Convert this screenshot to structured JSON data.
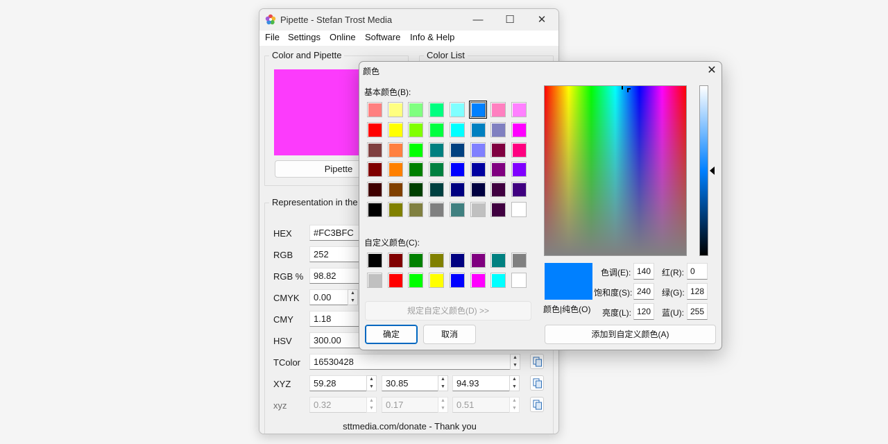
{
  "main_window": {
    "title": "Pipette - Stefan Trost Media",
    "controls": {
      "minimize": "—",
      "maximize": "☐",
      "close": "✕"
    },
    "menu": [
      "File",
      "Settings",
      "Online",
      "Software",
      "Info & Help"
    ],
    "color_group": {
      "legend": "Color and Pipette",
      "current_color": "#fc3bfc",
      "pipette_button": "Pipette"
    },
    "color_list_legend": "Color List",
    "representation": {
      "legend": "Representation in the",
      "rows": [
        {
          "label": "HEX",
          "values": [
            "#FC3BFC"
          ]
        },
        {
          "label": "RGB",
          "values": [
            "252"
          ]
        },
        {
          "label": "RGB %",
          "values": [
            "98.82"
          ]
        },
        {
          "label": "CMYK",
          "values": [
            "0.00"
          ]
        },
        {
          "label": "CMY",
          "values": [
            "1.18"
          ]
        },
        {
          "label": "HSV",
          "values": [
            "300.00"
          ]
        },
        {
          "label": "TColor",
          "values": [
            "16530428"
          ]
        },
        {
          "label": "XYZ",
          "values": [
            "59.28",
            "30.85",
            "94.93"
          ]
        },
        {
          "label": "xyz",
          "values": [
            "0.32",
            "0.17",
            "0.51"
          ]
        }
      ]
    },
    "footer": "sttmedia.com/donate - Thank you"
  },
  "color_dialog": {
    "title": "颜色",
    "close": "✕",
    "basic_label": "基本颜色(B):",
    "basic_colors": [
      [
        "#ff8080",
        "#ffff80",
        "#80ff80",
        "#00ff80",
        "#80ffff",
        "#0080ff",
        "#ff80c0",
        "#ff80ff"
      ],
      [
        "#ff0000",
        "#ffff00",
        "#80ff00",
        "#00ff40",
        "#00ffff",
        "#0080c0",
        "#8080c0",
        "#ff00ff"
      ],
      [
        "#804040",
        "#ff8040",
        "#00ff00",
        "#008080",
        "#004080",
        "#8080ff",
        "#800040",
        "#ff0080"
      ],
      [
        "#800000",
        "#ff8000",
        "#008000",
        "#008040",
        "#0000ff",
        "#0000a0",
        "#800080",
        "#8000ff"
      ],
      [
        "#400000",
        "#804000",
        "#004000",
        "#004040",
        "#000080",
        "#000040",
        "#400040",
        "#400080"
      ],
      [
        "#000000",
        "#808000",
        "#808040",
        "#808080",
        "#408080",
        "#c0c0c0",
        "#400040",
        "#ffffff"
      ]
    ],
    "selected_basic": "#0080ff",
    "custom_label": "自定义颜色(C):",
    "custom_colors": [
      [
        "#000000",
        "#800000",
        "#008000",
        "#808000",
        "#000080",
        "#800080",
        "#008080",
        "#808080"
      ],
      [
        "#c0c0c0",
        "#ff0000",
        "#00ff00",
        "#ffff00",
        "#0000ff",
        "#ff00ff",
        "#00ffff",
        "#ffffff"
      ]
    ],
    "define_custom_button": "规定自定义颜色(D) >>",
    "ok_button": "确定",
    "cancel_button": "取消",
    "preview_color": "#0080ff",
    "preview_label": "颜色|纯色(O)",
    "hue_label": "色调(E):",
    "hue": "140",
    "sat_label": "饱和度(S):",
    "sat": "240",
    "lum_label": "亮度(L):",
    "lum": "120",
    "red_label": "红(R):",
    "red": "0",
    "green_label": "绿(G):",
    "green": "128",
    "blue_label": "蓝(U):",
    "blue": "255",
    "add_custom_button": "添加到自定义颜色(A)"
  }
}
